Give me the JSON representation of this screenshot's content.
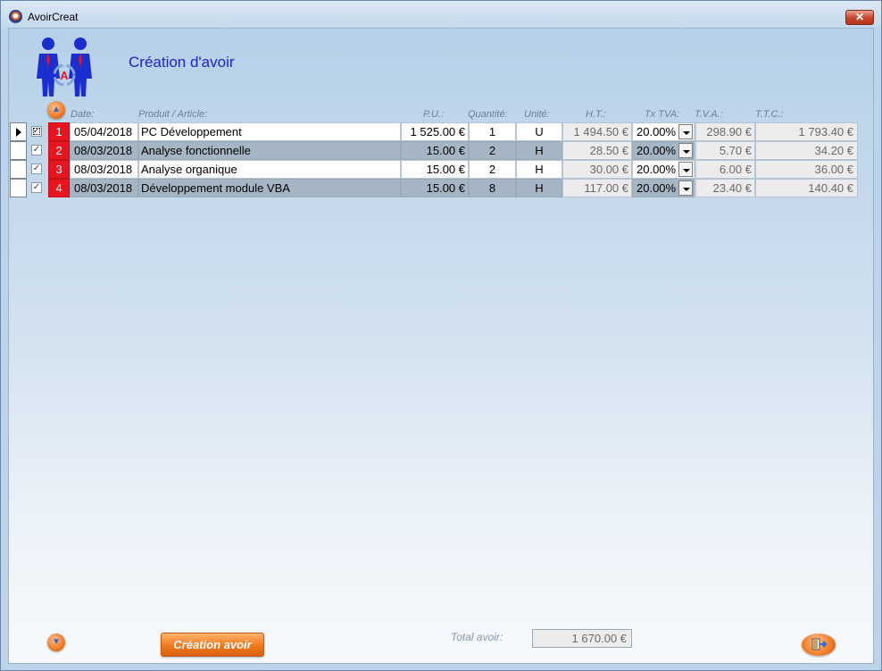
{
  "window": {
    "title": "AvoirCreat",
    "close_glyph": "✕"
  },
  "form": {
    "title": "Création d'avoir",
    "logo_icon": "two-people-circular-arrows-icon",
    "logo_letter": "A"
  },
  "headers": {
    "date": "Date:",
    "product": "Produit / Article:",
    "pu": "P.U.:",
    "qty": "Quantité:",
    "unit": "Unité:",
    "ht": "H.T.:",
    "tx_tva": "Tx TVA:",
    "tva": "T.V.A.:",
    "ttc": "T.T.C.:"
  },
  "rows": [
    {
      "checked": true,
      "num": "1",
      "date": "05/04/2018",
      "product": "PC Développement",
      "pu": "1 525.00 €",
      "qty": "1",
      "unit": "U",
      "ht": "1 494.50 €",
      "tx_tva": "20.00%",
      "tva": "298.90 €",
      "ttc": "1 793.40 €"
    },
    {
      "checked": true,
      "num": "2",
      "date": "08/03/2018",
      "product": "Analyse fonctionnelle",
      "pu": "15.00 €",
      "qty": "2",
      "unit": "H",
      "ht": "28.50 €",
      "tx_tva": "20.00%",
      "tva": "5.70 €",
      "ttc": "34.20 €"
    },
    {
      "checked": true,
      "num": "3",
      "date": "08/03/2018",
      "product": "Analyse organique",
      "pu": "15.00 €",
      "qty": "2",
      "unit": "H",
      "ht": "30.00 €",
      "tx_tva": "20.00%",
      "tva": "6.00 €",
      "ttc": "36.00 €"
    },
    {
      "checked": true,
      "num": "4",
      "date": "08/03/2018",
      "product": "Développement module VBA",
      "pu": "15.00 €",
      "qty": "8",
      "unit": "H",
      "ht": "117.00 €",
      "tx_tva": "20.00%",
      "tva": "23.40 €",
      "ttc": "140.40 €"
    }
  ],
  "footer": {
    "total_label": "Total avoir:",
    "total_value": "1 670.00 €",
    "create_button": "Création avoir",
    "exit_icon": "exit-door-icon",
    "nav_up_icon": "arrow-up-icon",
    "nav_down_icon": "arrow-down-icon"
  },
  "colors": {
    "accent_orange": "#f07a1e",
    "line_number_red": "#e8141e",
    "title_blue": "#1b22d6",
    "alt_row": "#a5b5c3"
  }
}
